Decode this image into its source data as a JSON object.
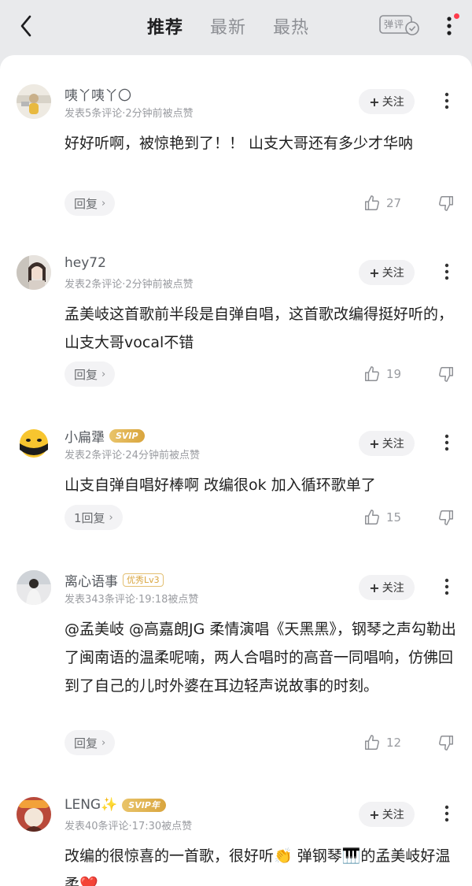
{
  "header": {
    "tabs": [
      {
        "label": "推荐",
        "active": true
      },
      {
        "label": "最新",
        "active": false
      },
      {
        "label": "最热",
        "active": false
      }
    ],
    "danmu_label": "弹评"
  },
  "comments": [
    {
      "username": "咦丫咦丫〇",
      "meta": "发表5条评论·2分钟前被点赞",
      "follow": "关注",
      "text": "好好听啊，被惊艳到了！！ 山支大哥还有多少才华呐",
      "reply": "回复",
      "likes": "27"
    },
    {
      "username": "hey72",
      "meta": "发表2条评论·2分钟前被点赞",
      "follow": "关注",
      "text": "孟美岐这首歌前半段是自弹自唱，这首歌改编得挺好听的，山支大哥vocal不错",
      "reply": "回复",
      "likes": "19"
    },
    {
      "username": "小扁犟",
      "badge": "SVIP",
      "meta": "发表2条评论·24分钟前被点赞",
      "follow": "关注",
      "text": "山支自弹自唱好棒啊 改编很ok 加入循环歌单了",
      "reply": "1回复",
      "likes": "15"
    },
    {
      "username": "离心语事",
      "badge": "优秀Lv3",
      "meta": "发表343条评论·19:18被点赞",
      "follow": "关注",
      "text": "@孟美岐 @高嘉朗JG 柔情演唱《天黑黑》，钢琴之声勾勒出了闽南语的温柔呢喃，两人合唱时的高音一同唱响，仿佛回到了自己的儿时外婆在耳边轻声说故事的时刻。",
      "reply": "回复",
      "likes": "12"
    },
    {
      "username": "LENG✨",
      "badge": "SVIP年",
      "meta": "发表40条评论·17:30被点赞",
      "follow": "关注",
      "text": "改编的很惊喜的一首歌，很好听👏 弹钢琴🎹的孟美岐好温柔❤️",
      "reply": "",
      "likes": ""
    }
  ],
  "icons": {
    "back": "chevron-left-icon",
    "more": "more-vertical-icon",
    "like": "thumbs-up-icon",
    "dislike": "thumbs-down-icon"
  },
  "colors": {
    "accent_gold": "#d9a53e",
    "header_bg": "#e9eaec",
    "red_dot": "#ff3b4b"
  }
}
